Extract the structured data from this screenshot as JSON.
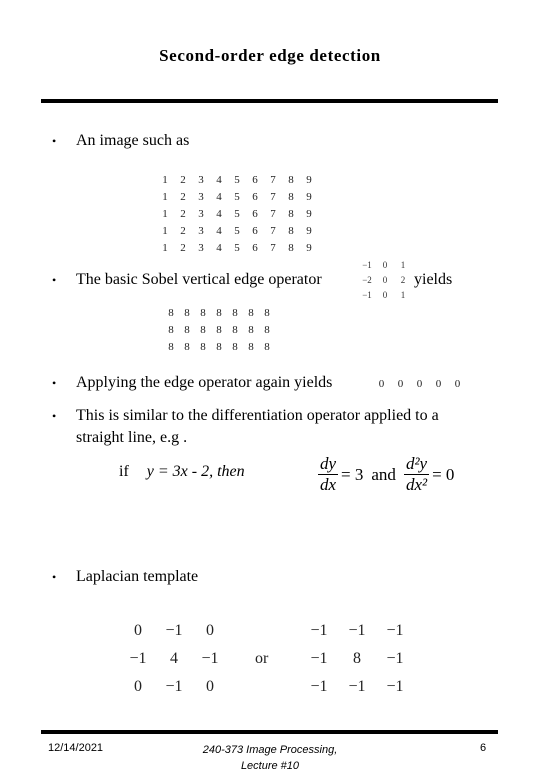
{
  "slide": {
    "title": "Second-order edge detection"
  },
  "bullets": {
    "b1": "An image such as",
    "b2_pre": "The basic Sobel vertical edge operator",
    "b2_post": "yields",
    "b3": "Applying the edge operator again yields",
    "b4_line1": "This is similar to the differentiation operator applied to a",
    "b4_line2": "straight line, e.g .",
    "b5": "Laplacian template",
    "bullet_glyph": "•"
  },
  "image_matrix": [
    [
      "1",
      "2",
      "3",
      "4",
      "5",
      "6",
      "7",
      "8",
      "9"
    ],
    [
      "1",
      "2",
      "3",
      "4",
      "5",
      "6",
      "7",
      "8",
      "9"
    ],
    [
      "1",
      "2",
      "3",
      "4",
      "5",
      "6",
      "7",
      "8",
      "9"
    ],
    [
      "1",
      "2",
      "3",
      "4",
      "5",
      "6",
      "7",
      "8",
      "9"
    ],
    [
      "1",
      "2",
      "3",
      "4",
      "5",
      "6",
      "7",
      "8",
      "9"
    ]
  ],
  "sobel_operator": [
    [
      "−1",
      "0",
      "1"
    ],
    [
      "−2",
      "0",
      "2"
    ],
    [
      "−1",
      "0",
      "1"
    ]
  ],
  "sobel_result": [
    [
      "8",
      "8",
      "8",
      "8",
      "8",
      "8",
      "8"
    ],
    [
      "8",
      "8",
      "8",
      "8",
      "8",
      "8",
      "8"
    ],
    [
      "8",
      "8",
      "8",
      "8",
      "8",
      "8",
      "8"
    ]
  ],
  "second_result": [
    "0",
    "0",
    "0",
    "0",
    "0"
  ],
  "equation": {
    "if_label": "if",
    "y_expr": "y = 3x - 2, then",
    "dy": "dy",
    "dx": "dx",
    "eq3": "= 3",
    "and": "and",
    "d2y": "d²y",
    "dx2": "dx²",
    "eq0": "= 0"
  },
  "laplacian": {
    "left": [
      [
        "0",
        "−1",
        "0"
      ],
      [
        "−1",
        "4",
        "−1"
      ],
      [
        "0",
        "−1",
        "0"
      ]
    ],
    "or": "or",
    "right": [
      [
        "−1",
        "−1",
        "−1"
      ],
      [
        "−1",
        "8",
        "−1"
      ],
      [
        "−1",
        "−1",
        "−1"
      ]
    ]
  },
  "footer": {
    "date": "12/14/2021",
    "course_line1": "240-373 Image Processing,",
    "course_line2": "Lecture #10",
    "page": "6"
  }
}
